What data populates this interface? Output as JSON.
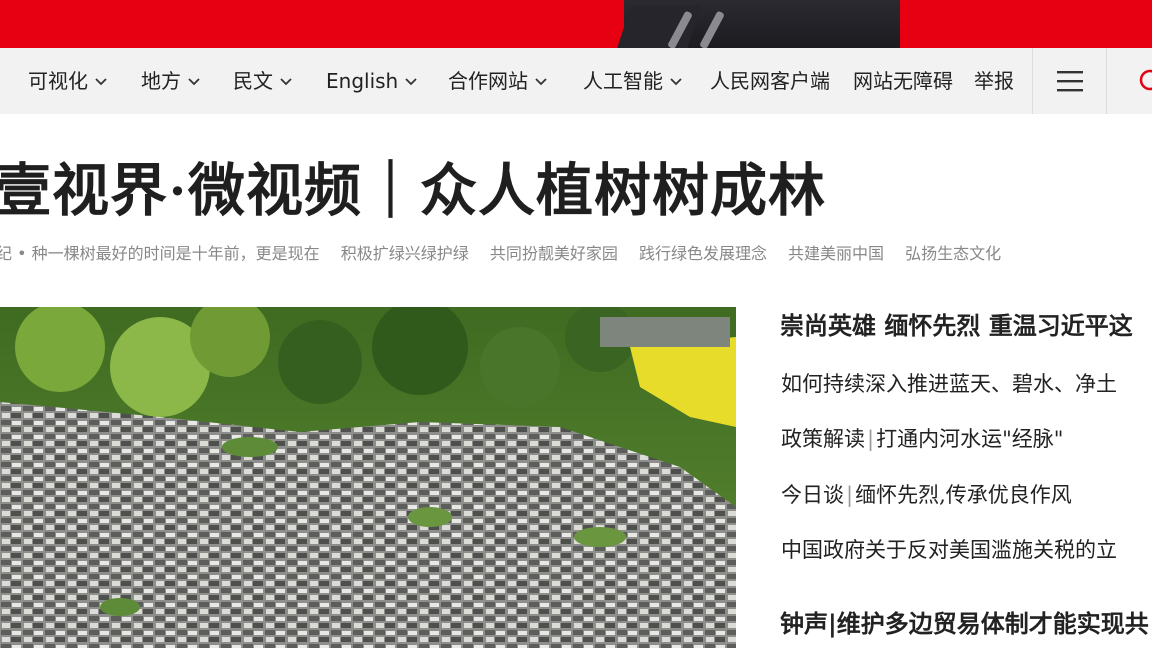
{
  "banner": {
    "color": "#e60012"
  },
  "nav": {
    "items": [
      {
        "label": "可视化",
        "dropdown": true
      },
      {
        "label": "地方",
        "dropdown": true
      },
      {
        "label": "民文",
        "dropdown": true
      },
      {
        "label": "English",
        "dropdown": true
      },
      {
        "label": "合作网站",
        "dropdown": true
      },
      {
        "label": "人工智能",
        "dropdown": true
      },
      {
        "label": "人民网客户端",
        "dropdown": false
      },
      {
        "label": "网站无障碍",
        "dropdown": false
      },
      {
        "label": "举报",
        "dropdown": false
      }
    ],
    "menu_icon": "hamburger-menu-icon",
    "search_icon": "search-icon"
  },
  "headline": "壹视界·微视频｜众人植树树成林",
  "subtitles": [
    "纪 • 种一棵树最好的时间是十年前，更是现在",
    "积极扩绿兴绿护绿",
    "共同扮靓美好家园",
    "践行绿色发展理念",
    "共建美丽中国",
    "弘扬生态文化"
  ],
  "side": {
    "title1": "崇尚英雄 缅怀先烈 重温习近平这",
    "links": [
      {
        "prefix": "",
        "text": "如何持续深入推进蓝天、碧水、净土"
      },
      {
        "prefix": "政策解读",
        "text": "打通内河水运\"经脉\""
      },
      {
        "prefix": "今日谈",
        "text": "缅怀先烈,传承优良作风"
      },
      {
        "prefix": "",
        "text": "中国政府关于反对美国滥施关税的立"
      }
    ],
    "title2": "钟声|维护多边贸易体制才能实现共"
  }
}
